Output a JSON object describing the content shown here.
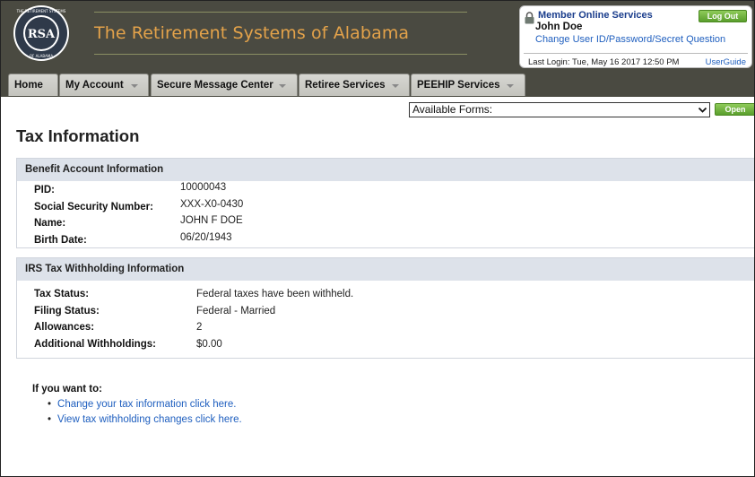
{
  "header": {
    "site_title": "The Retirement Systems of Alabama",
    "logo_text": "RSA",
    "logo_ring_text": "THE RETIREMENT SYSTEMS OF ALABAMA"
  },
  "member_box": {
    "title": "Member Online Services",
    "name": "John Doe",
    "change_link": "Change User ID/Password/Secret Question",
    "last_login": "Last Login: Tue, May 16 2017 12:50 PM",
    "userguide": "UserGuide",
    "logout_label": "Log Out"
  },
  "nav": {
    "tabs": [
      {
        "label": "Home"
      },
      {
        "label": "My Account"
      },
      {
        "label": "Secure Message Center"
      },
      {
        "label": "Retiree Services"
      },
      {
        "label": "PEEHIP Services"
      }
    ]
  },
  "forms": {
    "selected": "Available Forms:",
    "open_label": "Open"
  },
  "page": {
    "title": "Tax Information"
  },
  "benefit": {
    "heading": "Benefit Account Information",
    "rows": [
      {
        "label": "PID:",
        "value": "10000043"
      },
      {
        "label": "Social Security Number:",
        "value": "XXX-X0-0430"
      },
      {
        "label": "Name:",
        "value": "JOHN F DOE"
      },
      {
        "label": "Birth Date:",
        "value": "06/20/1943"
      }
    ]
  },
  "irs": {
    "heading": "IRS Tax Withholding Information",
    "rows": [
      {
        "label": "Tax Status:",
        "value": "Federal taxes have been withheld."
      },
      {
        "label": "Filing Status:",
        "value": "Federal - Married"
      },
      {
        "label": "Allowances:",
        "value": "2"
      },
      {
        "label": "Additional Withholdings:",
        "value": "$0.00"
      }
    ]
  },
  "actions": {
    "intro": "If you want to:",
    "links": [
      {
        "text": "Change your tax information click here."
      },
      {
        "text": "View tax withholding changes click here."
      }
    ]
  },
  "colors": {
    "header_bg": "#4a4a41",
    "title_orange": "#e3a24a",
    "link_blue": "#1f5fbf",
    "button_green": "#5a9e2c"
  }
}
